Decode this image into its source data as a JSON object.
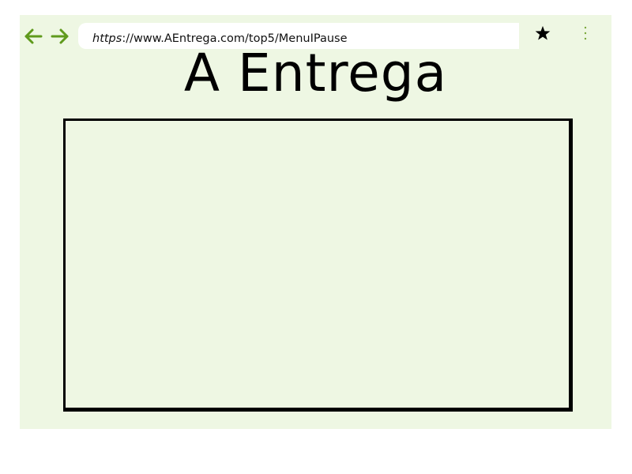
{
  "browser": {
    "url_scheme": "https",
    "url_rest": "://www.AEntrega.com/top5/MenuIPause",
    "icons": [
      "back-arrow-icon",
      "forward-arrow-icon",
      "star-icon",
      "kebab-menu-icon"
    ]
  },
  "page": {
    "title": "A Entrega"
  },
  "colors": {
    "window_background": "#eef7e3",
    "nav_arrows": "#5f9a1c",
    "menu_dots": "#7aa83b",
    "frame_border": "#000000"
  }
}
